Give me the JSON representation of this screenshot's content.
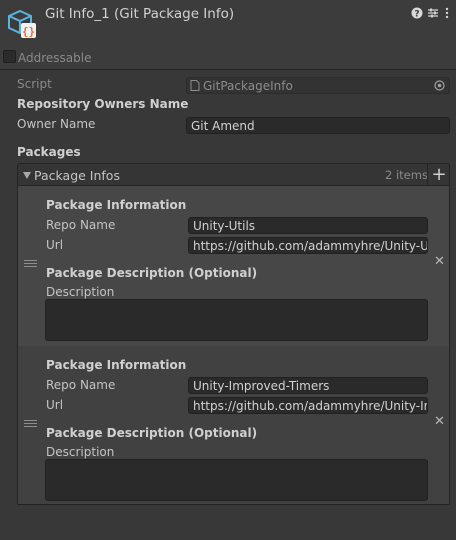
{
  "header": {
    "title": "Git Info_1 (Git Package Info)",
    "help_icon": "help-icon",
    "presets_icon": "presets-icon",
    "menu_icon": "kebab-menu-icon"
  },
  "addressable": {
    "label": "Addressable",
    "checked": false
  },
  "script": {
    "label": "Script",
    "value": "GitPackageInfo"
  },
  "repo_owners": {
    "heading": "Repository Owners Name",
    "owner_label": "Owner Name",
    "owner_value": "Git Amend"
  },
  "packages": {
    "heading": "Packages",
    "list_label": "Package Infos",
    "count": "2 items",
    "items": [
      {
        "info_heading": "Package Information",
        "repo_label": "Repo Name",
        "repo_value": "Unity-Utils",
        "url_label": "Url",
        "url_value": "https://github.com/adammyhre/Unity-Utils",
        "desc_heading": "Package Description (Optional)",
        "desc_label": "Description",
        "desc_value": ""
      },
      {
        "info_heading": "Package Information",
        "repo_label": "Repo Name",
        "repo_value": "Unity-Improved-Timers",
        "url_label": "Url",
        "url_value": "https://github.com/adammyhre/Unity-Improved-Timers",
        "desc_heading": "Package Description (Optional)",
        "desc_label": "Description",
        "desc_value": ""
      }
    ]
  },
  "colors": {
    "background": "#383838",
    "field": "#2a2a2a",
    "icon_blue": "#5ab4e0",
    "icon_orange": "#e8703a"
  }
}
